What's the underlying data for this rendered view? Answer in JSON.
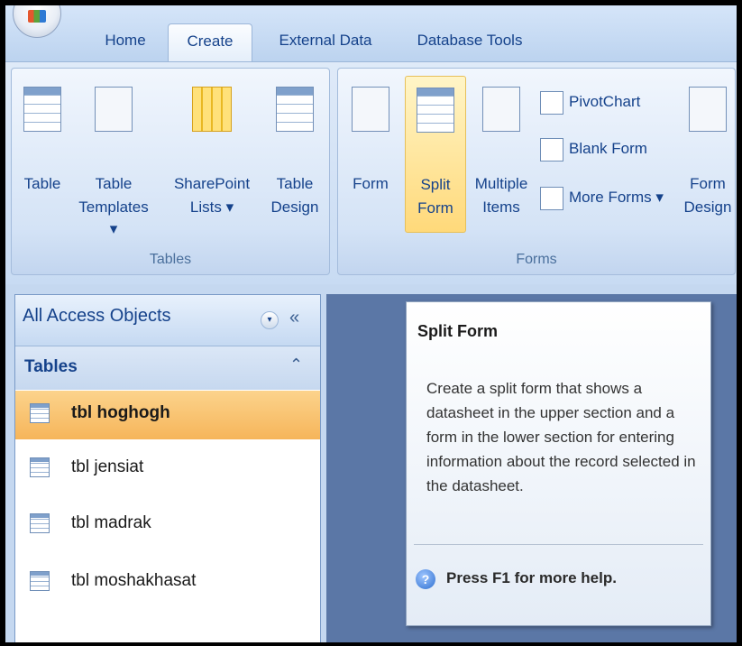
{
  "tabs": [
    {
      "label": "Home"
    },
    {
      "label": "Create",
      "active": true
    },
    {
      "label": "External Data"
    },
    {
      "label": "Database Tools"
    }
  ],
  "ribbon": {
    "tables_group": {
      "label": "Tables",
      "table": "Table",
      "table_templates_1": "Table",
      "table_templates_2": "Templates ▾",
      "sharepoint_1": "SharePoint",
      "sharepoint_2": "Lists ▾",
      "table_design_1": "Table",
      "table_design_2": "Design"
    },
    "forms_group": {
      "label": "Forms",
      "form": "Form",
      "split_form_1": "Split",
      "split_form_2": "Form",
      "multiple_items_1": "Multiple",
      "multiple_items_2": "Items",
      "pivotchart": "PivotChart",
      "blank_form": "Blank Form",
      "more_forms": "More Forms ▾",
      "form_design_1": "Form",
      "form_design_2": "Design"
    }
  },
  "nav": {
    "title": "All Access Objects",
    "dropdown_glyph": "▾",
    "collapse_glyph": "«",
    "group_title": "Tables",
    "group_chevron": "⌃",
    "items": [
      {
        "label": "tbl hoghogh",
        "selected": true
      },
      {
        "label": "tbl jensiat"
      },
      {
        "label": "tbl madrak"
      },
      {
        "label": "tbl moshakhasat"
      }
    ]
  },
  "tooltip": {
    "title": "Split Form",
    "body": "Create a split form that shows a datasheet in the upper section and a form in the lower section for entering information about the record selected in the datasheet.",
    "help_glyph": "?",
    "help": "Press F1 for more help."
  },
  "colors": {
    "ribbon_text": "#15428b",
    "selected_row": "#f6b55a",
    "work_area": "#5b77a6"
  }
}
